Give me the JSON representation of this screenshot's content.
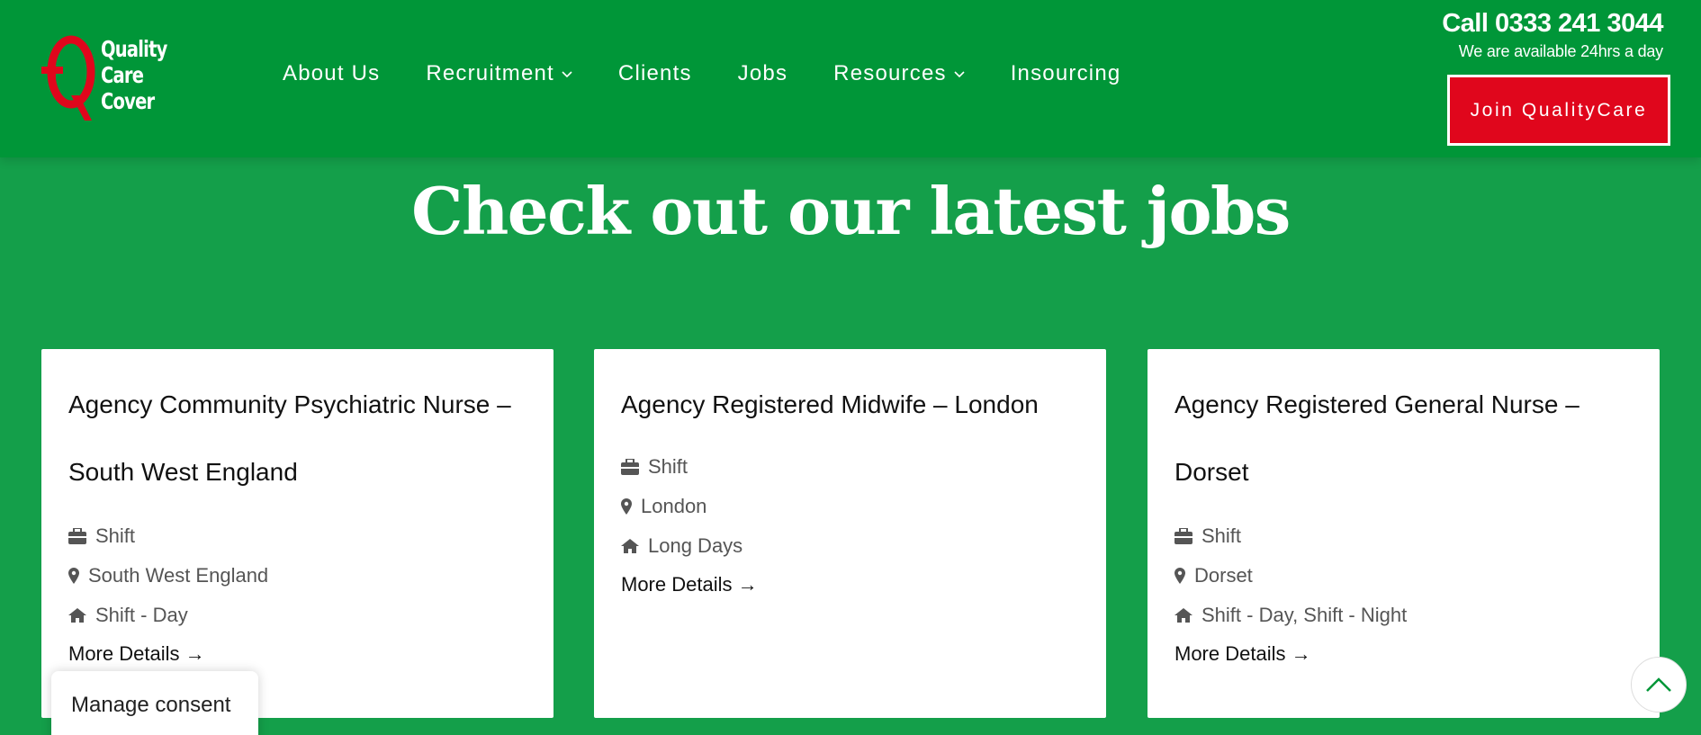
{
  "brand": {
    "logo_lines": [
      "Quality",
      "Care",
      "Cover"
    ],
    "logo_alt": "QCC",
    "colors": {
      "green": "#009638",
      "bg_green": "#149f4a",
      "red": "#e0061c",
      "white": "#ffffff"
    }
  },
  "nav": {
    "items": [
      {
        "label": "About Us",
        "icon": null
      },
      {
        "label": "Recruitment",
        "icon": "chevron-down-icon"
      },
      {
        "label": "Clients",
        "icon": null
      },
      {
        "label": "Jobs",
        "icon": null
      },
      {
        "label": "Resources",
        "icon": "chevron-down-icon"
      },
      {
        "label": "Insourcing",
        "icon": null
      }
    ]
  },
  "contact": {
    "phone": "Call 0333 241 3044",
    "availability": "We are available 24hrs a day",
    "cta_label": "Join QualityCare"
  },
  "main": {
    "title": "Check out our latest jobs",
    "jobs": [
      {
        "title": "Agency Community Psychiatric Nurse – South West England",
        "type": "Shift",
        "location": "South West England",
        "shift": "Shift - Day",
        "link_label": "More Details →"
      },
      {
        "title": "Agency Registered  Midwife – London",
        "type": "Shift",
        "location": "London",
        "shift": "Long Days",
        "link_label": "More Details →"
      },
      {
        "title": "Agency Registered General Nurse – Dorset",
        "type": "Shift",
        "location": "Dorset",
        "shift": "Shift - Day, Shift - Night",
        "link_label": "More Details →"
      }
    ],
    "icons": {
      "type": "briefcase-icon",
      "location": "map-pin-icon",
      "shift": "home-icon"
    }
  },
  "consent": {
    "label": "Manage consent"
  },
  "scroll_top": {
    "icon": "chevron-up-icon"
  }
}
